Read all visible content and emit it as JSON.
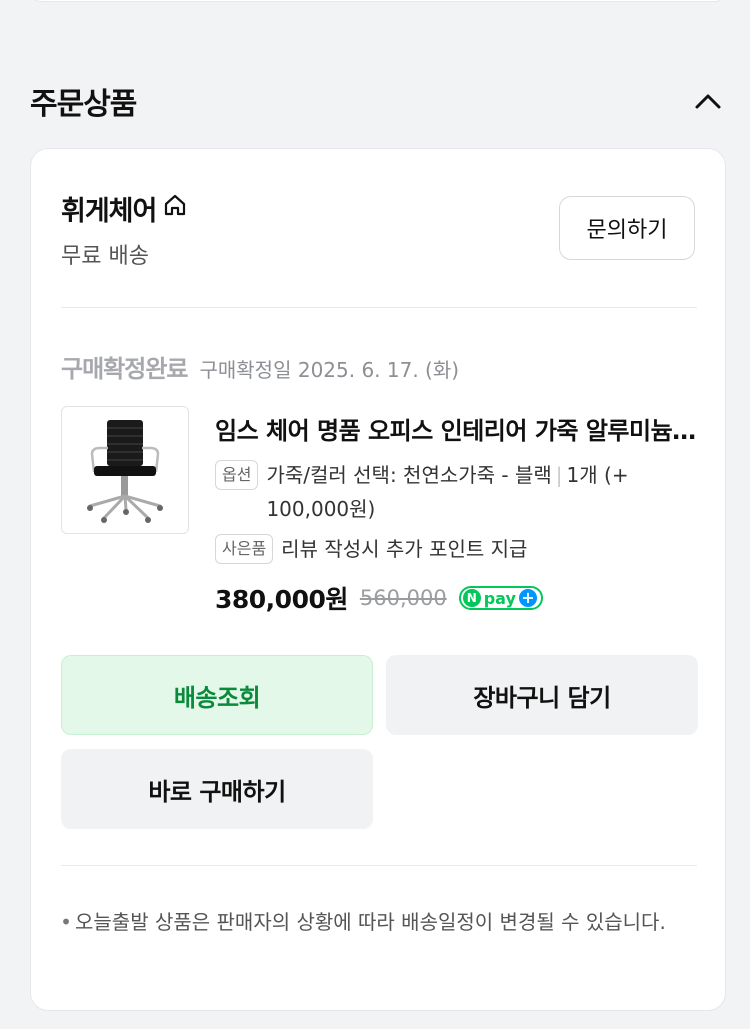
{
  "section": {
    "title": "주문상품"
  },
  "seller": {
    "name": "휘게체어",
    "shipping": "무료 배송",
    "inquiry_label": "문의하기"
  },
  "order": {
    "status": "구매확정완료",
    "confirmed_date": "구매확정일 2025. 6. 17. (화)"
  },
  "product": {
    "title": "임스 체어 명품 오피스 인테리어 가죽 알루미늄 의자",
    "option_tag": "옵션",
    "option_text": "가죽/컬러 선택: 천연소가죽 - 블랙",
    "quantity_text": "1개 (+ 100,000원)",
    "gift_tag": "사은품",
    "gift_text": "리뷰 작성시 추가 포인트 지급",
    "price": "380,000원",
    "original_price": "560,000",
    "npay_label": "pay"
  },
  "buttons": {
    "track": "배송조회",
    "cart": "장바구니 담기",
    "buy_now": "바로 구매하기"
  },
  "notice": "오늘출발 상품은 판매자의 상황에 따라 배송일정이 변경될 수 있습니다.",
  "colors": {
    "accent_green": "#03c75a",
    "track_text": "#0a8a3b",
    "track_bg": "#e3f8e9"
  }
}
